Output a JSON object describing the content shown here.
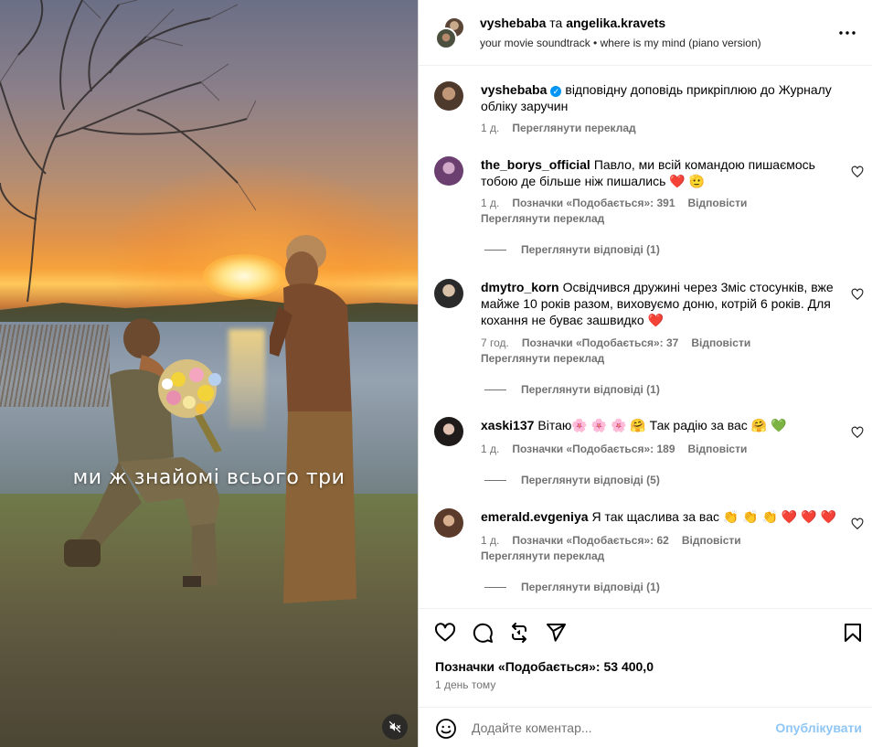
{
  "media": {
    "overlay_text": "ми ж знайомі всього три",
    "mute_icon": "speaker-muted-icon"
  },
  "header": {
    "user1": "vyshebaba",
    "joiner": " та ",
    "user2": "angelika.kravets",
    "subtitle": "your movie soundtrack • where is my mind (piano version)",
    "more_icon": "more-horizontal-icon"
  },
  "caption": {
    "user": "vyshebaba",
    "verified": true,
    "text": "відповідну доповідь прикріплюю до Журналу обліку заручин",
    "time": "1 д.",
    "see_translation": "Переглянути переклад"
  },
  "comments": [
    {
      "user": "the_borys_official",
      "text": "Павло, ми всій командою пишаємось тобою де більше ніж пишались ❤️ 🫡",
      "time": "1 д.",
      "likes": "Позначки «Подобається»: 391",
      "reply": "Відповісти",
      "see_translation": "Переглянути переклад",
      "replies": "Переглянути відповіді (1)"
    },
    {
      "user": "dmytro_korn",
      "text": "Освідчився дружині через 3міс стосунків, вже майже 10 років разом, виховуємо доню, котрій 6 років. Для кохання не буває зашвидко ❤️",
      "time": "7 год.",
      "likes": "Позначки «Подобається»: 37",
      "reply": "Відповісти",
      "see_translation": "Переглянути переклад",
      "replies": "Переглянути відповіді (1)"
    },
    {
      "user": "xaski137",
      "text": "Вітаю🌸 🌸 🌸 🤗 Так радію за вас 🤗 💚",
      "time": "1 д.",
      "likes": "Позначки «Подобається»: 189",
      "reply": "Відповісти",
      "replies": "Переглянути відповіді (5)"
    },
    {
      "user": "emerald.evgeniya",
      "text": "Я так щаслива за вас 👏 👏 👏 ❤️ ❤️ ❤️",
      "time": "1 д.",
      "likes": "Позначки «Подобається»: 62",
      "reply": "Відповісти",
      "see_translation": "Переглянути переклад",
      "replies": "Переглянути відповіді (1)"
    }
  ],
  "footer": {
    "likes": "Позначки «Подобається»: 53 400,0",
    "time": "1 день тому",
    "comment_placeholder": "Додайте коментар...",
    "publish": "Опублікувати",
    "icons": [
      "heart-icon",
      "comment-icon",
      "repost-icon",
      "share-icon",
      "bookmark-icon",
      "emoji-icon"
    ]
  },
  "colors": {
    "accent": "#0095f6",
    "publish_disabled": "#8fc6f5",
    "secondary_text": "#737373",
    "heart_red": "#e0245e"
  }
}
